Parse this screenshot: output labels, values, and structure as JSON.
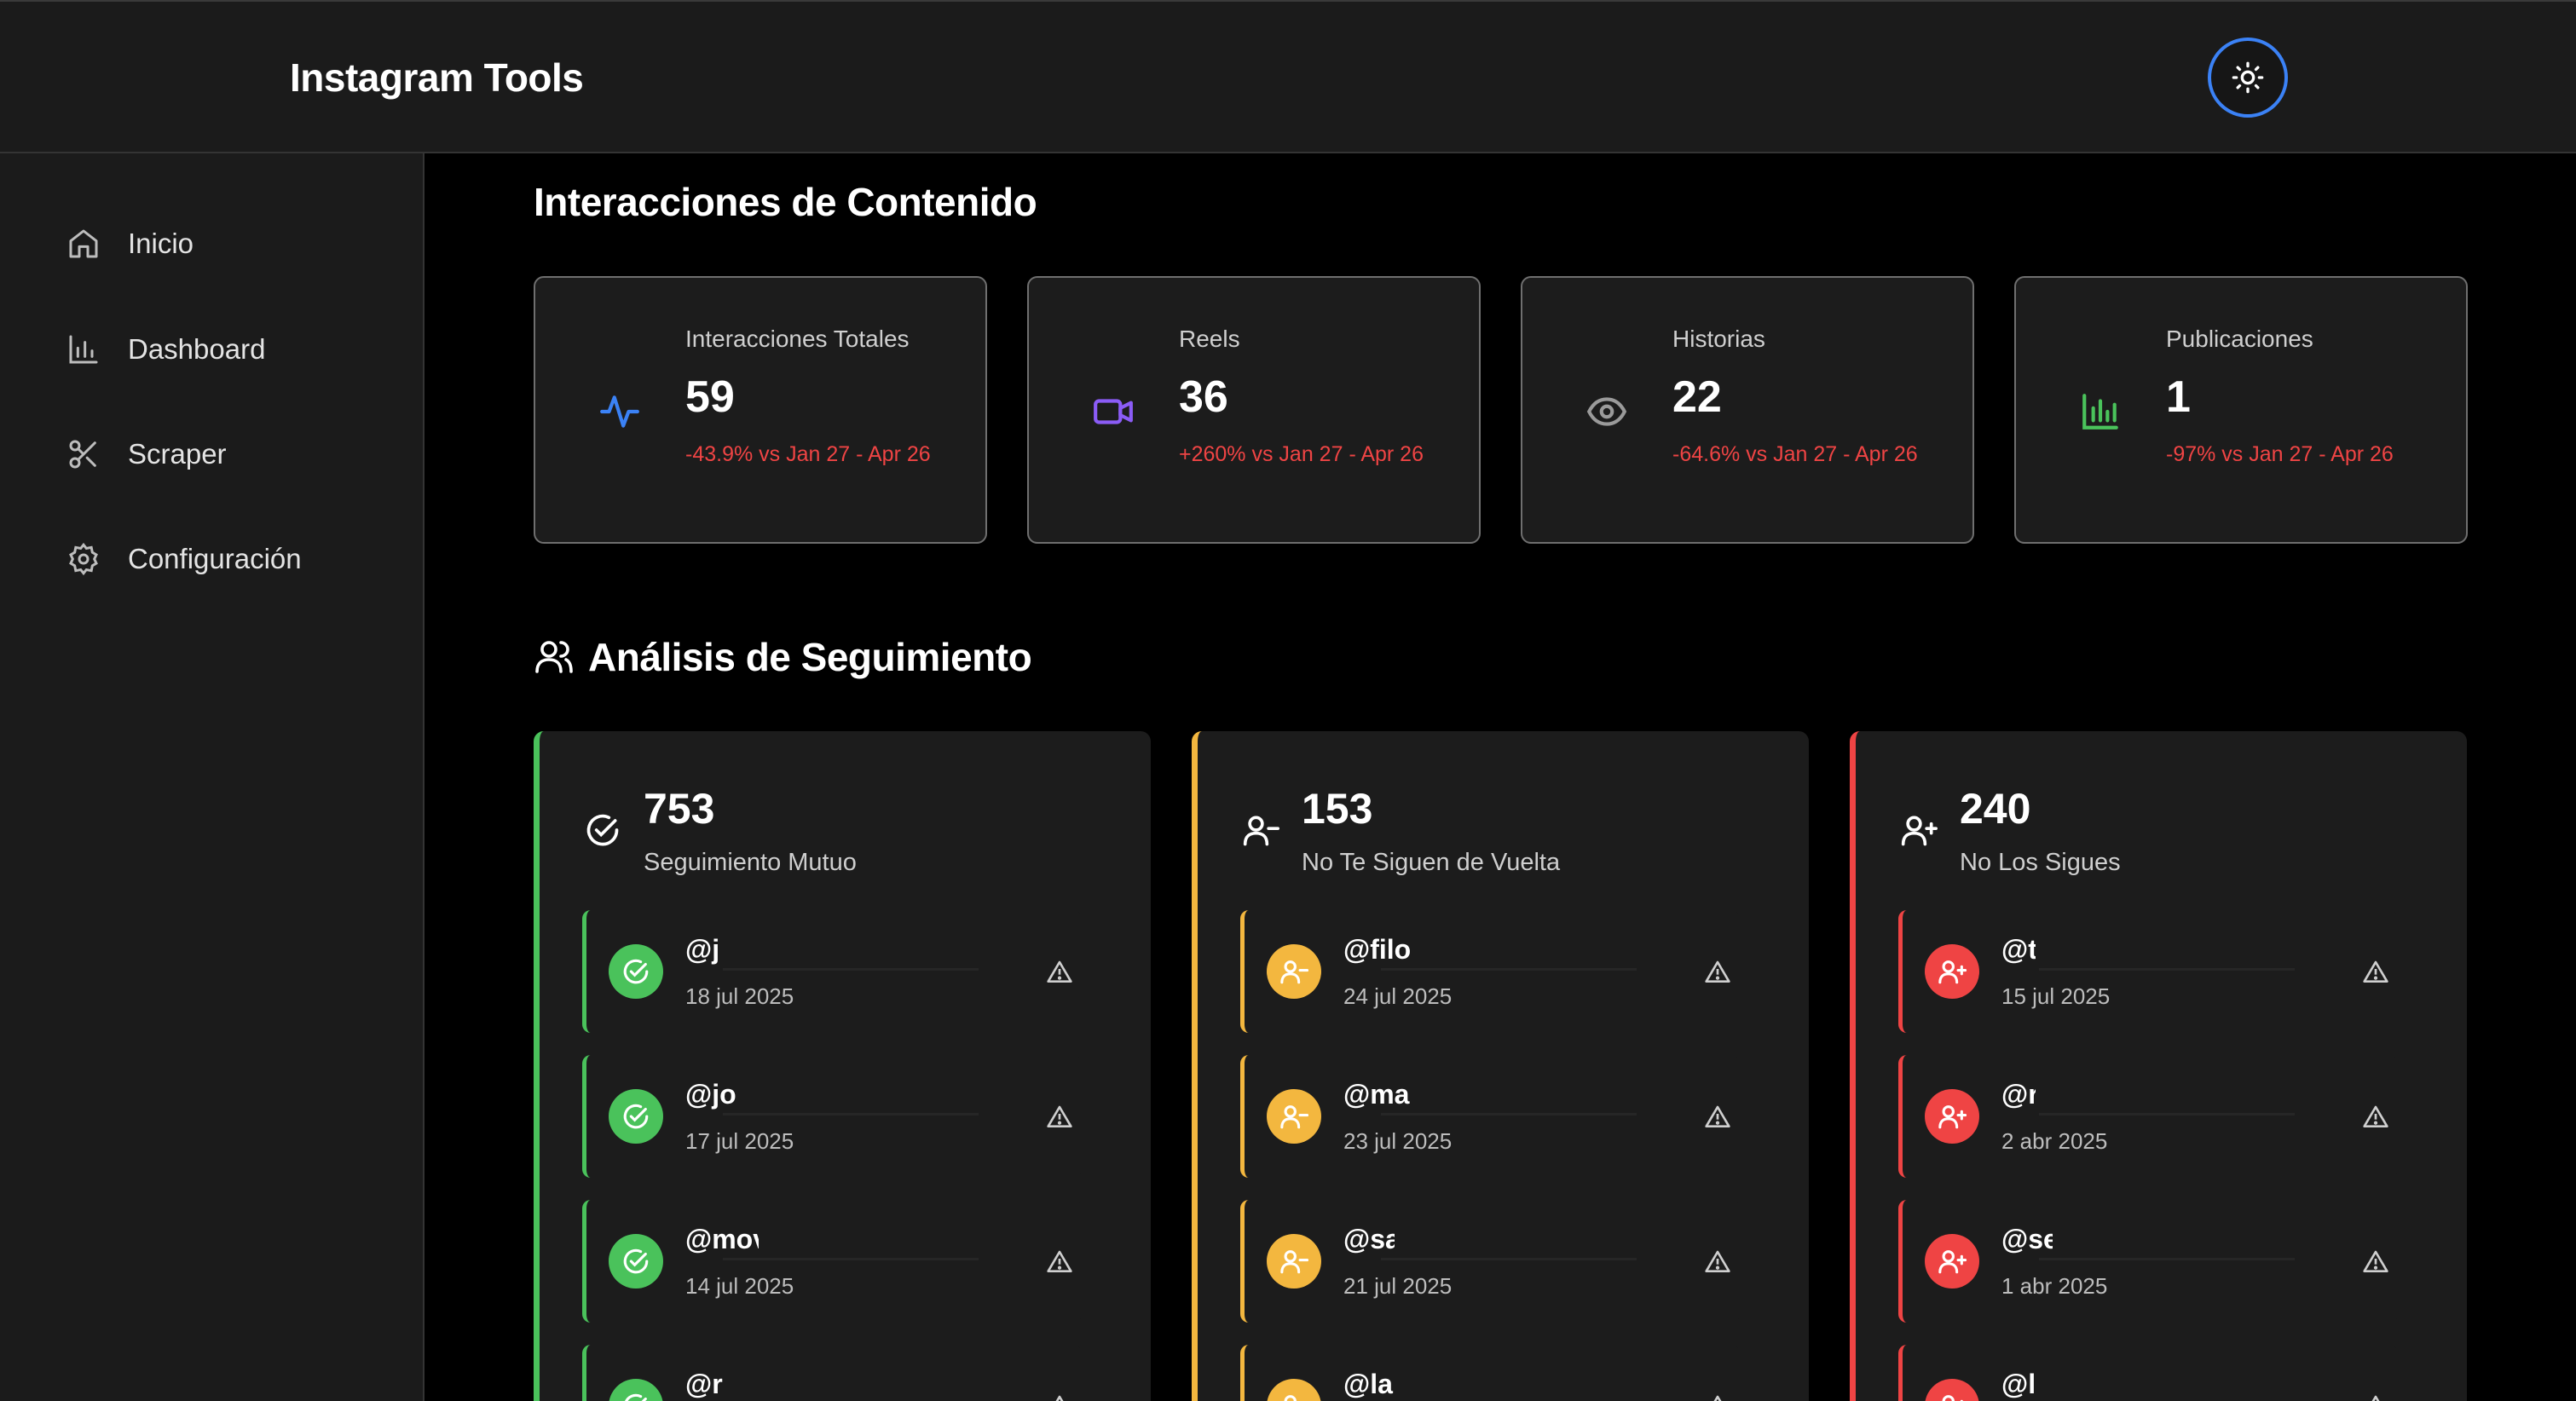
{
  "app": {
    "title": "Instagram Tools"
  },
  "colors": {
    "accent_blue": "#3b82f6",
    "green": "#4ac25b",
    "yellow": "#f3b73f",
    "red": "#ef4444",
    "purple": "#8b5cf6"
  },
  "sidebar": {
    "items": [
      {
        "label": "Inicio",
        "icon": "home-icon"
      },
      {
        "label": "Dashboard",
        "icon": "bar-chart-icon"
      },
      {
        "label": "Scraper",
        "icon": "scissors-icon"
      },
      {
        "label": "Configuración",
        "icon": "gear-icon"
      }
    ]
  },
  "interactions": {
    "title": "Interacciones de Contenido",
    "cards": [
      {
        "label": "Interacciones Totales",
        "value": "59",
        "delta": "-43.9% vs Jan 27 - Apr 26",
        "icon": "activity-icon"
      },
      {
        "label": "Reels",
        "value": "36",
        "delta": "+260% vs Jan 27 - Apr 26",
        "icon": "video-icon"
      },
      {
        "label": "Historias",
        "value": "22",
        "delta": "-64.6% vs Jan 27 - Apr 26",
        "icon": "eye-icon"
      },
      {
        "label": "Publicaciones",
        "value": "1",
        "delta": "-97% vs Jan 27 - Apr 26",
        "icon": "bar-chart-icon"
      }
    ]
  },
  "following": {
    "title": "Análisis de Seguimiento",
    "cards": [
      {
        "count": "753",
        "label": "Seguimiento Mutuo",
        "icon": "check-circle-icon",
        "users": [
          {
            "handle": "@j",
            "date": "18 jul 2025"
          },
          {
            "handle": "@jo",
            "date": "17 jul 2025"
          },
          {
            "handle": "@mov",
            "date": "14 jul 2025"
          },
          {
            "handle": "@r",
            "date": ""
          }
        ]
      },
      {
        "count": "153",
        "label": "No Te Siguen de Vuelta",
        "icon": "user-minus-icon",
        "users": [
          {
            "handle": "@filo",
            "date": "24 jul 2025"
          },
          {
            "handle": "@ma",
            "date": "23 jul 2025"
          },
          {
            "handle": "@sa",
            "date": "21 jul 2025"
          },
          {
            "handle": "@la",
            "date": ""
          }
        ]
      },
      {
        "count": "240",
        "label": "No Los Sigues",
        "icon": "user-plus-icon",
        "users": [
          {
            "handle": "@t",
            "date": "15 jul 2025"
          },
          {
            "handle": "@r",
            "date": "2 abr 2025"
          },
          {
            "handle": "@se",
            "date": "1 abr 2025"
          },
          {
            "handle": "@l",
            "date": ""
          }
        ]
      }
    ]
  }
}
